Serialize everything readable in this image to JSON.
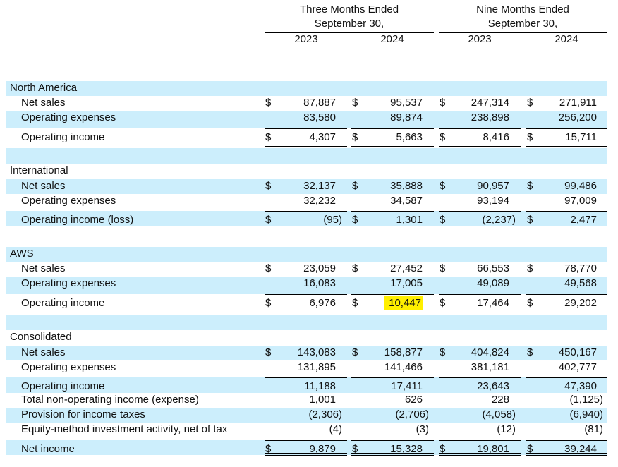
{
  "header": {
    "groups": [
      {
        "line1": "Three Months Ended",
        "line2": "September 30,",
        "years": [
          "2023",
          "2024"
        ]
      },
      {
        "line1": "Nine Months Ended",
        "line2": "September 30,",
        "years": [
          "2023",
          "2024"
        ]
      }
    ]
  },
  "highlight_color": "#ffef00",
  "band_color": "#cceefc",
  "rows": [
    {
      "label": "North America",
      "indent": false,
      "blue": true
    },
    {
      "label": "Net sales",
      "indent": true,
      "blue": false,
      "dollar": true,
      "values": [
        "87,887",
        "95,537",
        "247,314",
        "271,911"
      ]
    },
    {
      "label": "Operating expenses",
      "indent": true,
      "blue": true,
      "values": [
        "83,580",
        "89,874",
        "238,898",
        "256,200"
      ]
    },
    {
      "label": "Operating income",
      "indent": true,
      "blue": false,
      "dollar": true,
      "top_line": true,
      "double_line": true,
      "values": [
        "4,307",
        "5,663",
        "8,416",
        "15,711"
      ]
    },
    {
      "spacer": true,
      "blue": true
    },
    {
      "label": "International",
      "indent": false,
      "blue": false
    },
    {
      "label": "Net sales",
      "indent": true,
      "blue": true,
      "dollar": true,
      "values": [
        "32,137",
        "35,888",
        "90,957",
        "99,486"
      ]
    },
    {
      "label": "Operating expenses",
      "indent": true,
      "blue": false,
      "values": [
        "32,232",
        "34,587",
        "93,194",
        "97,009"
      ]
    },
    {
      "label": "Operating income (loss)",
      "indent": true,
      "blue": true,
      "dollar": true,
      "top_line": true,
      "double_line": true,
      "values": [
        "(95)",
        "1,301",
        "(2,237)",
        "2,477"
      ]
    },
    {
      "spacer": true,
      "blue": false
    },
    {
      "label": "AWS",
      "indent": false,
      "blue": true
    },
    {
      "label": "Net sales",
      "indent": true,
      "blue": false,
      "dollar": true,
      "values": [
        "23,059",
        "27,452",
        "66,553",
        "78,770"
      ]
    },
    {
      "label": "Operating expenses",
      "indent": true,
      "blue": true,
      "values": [
        "16,083",
        "17,005",
        "49,089",
        "49,568"
      ]
    },
    {
      "label": "Operating income",
      "indent": true,
      "blue": false,
      "dollar": true,
      "top_line": true,
      "double_line": true,
      "values": [
        "6,976",
        "10,447",
        "17,464",
        "29,202"
      ],
      "highlight_index": 1
    },
    {
      "spacer": true,
      "blue": true
    },
    {
      "label": "Consolidated",
      "indent": false,
      "blue": false
    },
    {
      "label": "Net sales",
      "indent": true,
      "blue": true,
      "dollar": true,
      "values": [
        "143,083",
        "158,877",
        "404,824",
        "450,167"
      ]
    },
    {
      "label": "Operating expenses",
      "indent": true,
      "blue": false,
      "values": [
        "131,895",
        "141,466",
        "381,181",
        "402,777"
      ]
    },
    {
      "label": "Operating income",
      "indent": true,
      "blue": true,
      "top_line": true,
      "values": [
        "11,188",
        "17,411",
        "23,643",
        "47,390"
      ]
    },
    {
      "label": "Total non-operating income (expense)",
      "indent": true,
      "blue": false,
      "values": [
        "1,001",
        "626",
        "228",
        "(1,125)"
      ]
    },
    {
      "label": "Provision for income taxes",
      "indent": true,
      "blue": true,
      "values": [
        "(2,306)",
        "(2,706)",
        "(4,058)",
        "(6,940)"
      ]
    },
    {
      "label": "Equity-method investment activity, net of tax",
      "indent": true,
      "blue": false,
      "values": [
        "(4)",
        "(3)",
        "(12)",
        "(81)"
      ]
    },
    {
      "label": "Net income",
      "indent": true,
      "blue": true,
      "dollar": true,
      "top_line": true,
      "double_line": true,
      "values": [
        "9,879",
        "15,328",
        "19,801",
        "39,244"
      ]
    }
  ],
  "dollar_sign": "$"
}
